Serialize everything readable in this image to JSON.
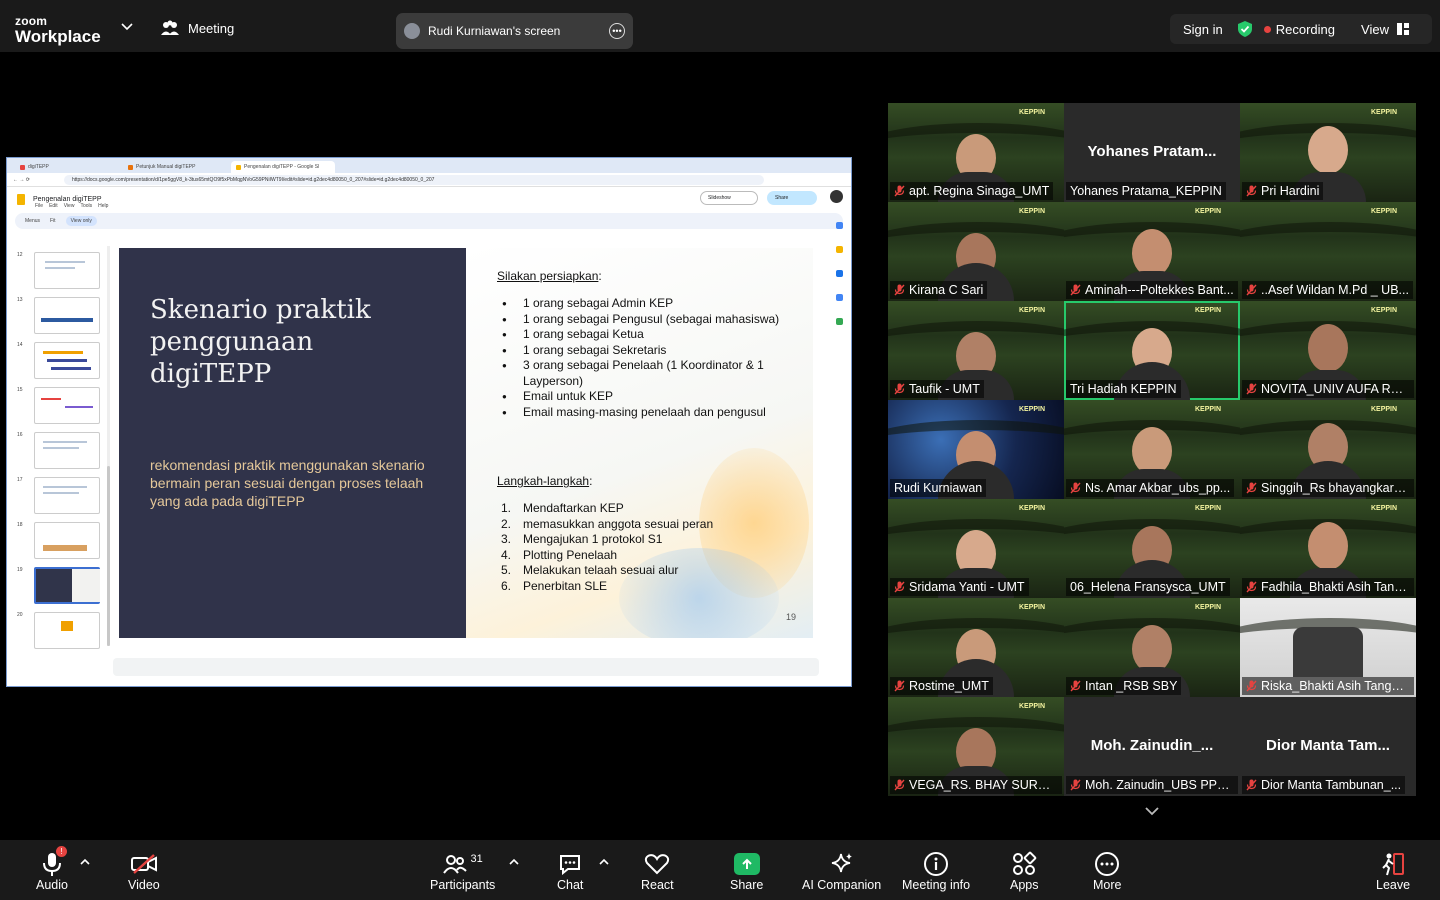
{
  "app": {
    "logo_line1": "zoom",
    "logo_line2": "Workplace",
    "meeting_label": "Meeting",
    "share_label": "Rudi Kurniawan's screen",
    "sign_in": "Sign in",
    "recording": "Recording",
    "view": "View"
  },
  "browser": {
    "tabs": [
      "digiTEPP",
      "Petunjuk Manual digiTEPP",
      "Pengenalan digiTEPP - Google Sl"
    ],
    "url": "https://docs.google.com/presentation/d/1pe5ggV8_k-3tus65mtQO9f5xPbMqgNVoG59PNiIWT9I/edit#slide=id.g2dec4d80050_0_207#slide=id.g2dec4d80050_0_207",
    "doc_title": "Pengenalan digiTEPP",
    "menus": [
      "File",
      "Edit",
      "View",
      "Tools",
      "Help"
    ],
    "slideshow": "Slideshow",
    "share": "Share",
    "toolbar_menus": "Menus",
    "toolbar_zoom": "Fit",
    "view_only": "View only",
    "thumb_numbers": [
      "12",
      "13",
      "14",
      "15",
      "16",
      "17",
      "18",
      "19",
      "20"
    ],
    "selected_slide": "19"
  },
  "slide": {
    "title": "Skenario praktik penggunaan digiTEPP",
    "subtitle": "rekomendasi praktik menggunakan skenario bermain peran sesuai dengan proses telaah yang ada pada digiTEPP",
    "prep_heading": "Silakan persiapkan",
    "prep_colon": ":",
    "prep_items": [
      "1 orang sebagai Admin KEP",
      "1 orang sebagai Pengusul (sebagai mahasiswa)",
      "1 orang sebagai Ketua",
      "1 orang sebagai Sekretaris",
      "3 orang sebagai Penelaah (1 Koordinator & 1 Layperson)",
      "Email untuk KEP",
      "Email masing-masing penelaah dan pengusul"
    ],
    "steps_heading": "Langkah-langkah",
    "steps_colon": ":",
    "steps": [
      "Mendaftarkan KEP",
      "memasukkan anggota sesuai peran",
      "Mengajukan 1 protokol S1",
      "Plotting Penelaah",
      "Melakukan telaah sesuai alur",
      "Penerbitan SLE"
    ],
    "page_number": "19"
  },
  "participants": [
    {
      "name": "apt. Regina Sinaga_UMT",
      "muted": true,
      "video": true,
      "big": ""
    },
    {
      "name": "Yohanes Pratama_KEPPIN",
      "muted": false,
      "video": false,
      "big": "Yohanes  Pratam..."
    },
    {
      "name": "Pri Hardini",
      "muted": true,
      "video": true,
      "big": ""
    },
    {
      "name": "Kirana C Sari",
      "muted": true,
      "video": true,
      "big": ""
    },
    {
      "name": "Aminah---Poltekkes Bant...",
      "muted": true,
      "video": true,
      "big": ""
    },
    {
      "name": "..Asef Wildan M.Pd _ UB...",
      "muted": true,
      "video": true,
      "big": ""
    },
    {
      "name": "Taufik - UMT",
      "muted": true,
      "video": true,
      "big": ""
    },
    {
      "name": "Tri Hadiah KEPPIN",
      "muted": false,
      "video": true,
      "big": ""
    },
    {
      "name": "NOVITA_UNIV AUFA RO...",
      "muted": true,
      "video": true,
      "big": ""
    },
    {
      "name": "Rudi Kurniawan",
      "muted": false,
      "video": true,
      "big": ""
    },
    {
      "name": "Ns. Amar Akbar_ubs_pp...",
      "muted": true,
      "video": true,
      "big": ""
    },
    {
      "name": "Singgih_Rs bhayangkara...",
      "muted": true,
      "video": true,
      "big": ""
    },
    {
      "name": "Sridama Yanti - UMT",
      "muted": true,
      "video": true,
      "big": ""
    },
    {
      "name": "06_Helena Fransysca_UMT",
      "muted": false,
      "video": true,
      "big": ""
    },
    {
      "name": "Fadhila_Bhakti Asih Tang...",
      "muted": true,
      "video": true,
      "big": ""
    },
    {
      "name": "Rostime_UMT",
      "muted": true,
      "video": true,
      "big": ""
    },
    {
      "name": "Intan _RSB SBY",
      "muted": true,
      "video": true,
      "big": ""
    },
    {
      "name": "Riska_Bhakti Asih Tanger...",
      "muted": true,
      "video": true,
      "big": ""
    },
    {
      "name": "VEGA_RS. BHAY SURABA...",
      "muted": true,
      "video": true,
      "big": ""
    },
    {
      "name": "Moh. Zainudin_UBS PPNI...",
      "muted": true,
      "video": false,
      "big": "Moh.  Zainudin_..."
    },
    {
      "name": "Dior Manta Tambunan_...",
      "muted": true,
      "video": false,
      "big": "Dior  Manta  Tam..."
    }
  ],
  "bottom": {
    "audio": "Audio",
    "audio_badge": "!",
    "video": "Video",
    "participants": "Participants",
    "participants_count": "31",
    "chat": "Chat",
    "react": "React",
    "share": "Share",
    "ai": "AI Companion",
    "info": "Meeting info",
    "apps": "Apps",
    "more": "More",
    "leave": "Leave"
  },
  "colors": {
    "accent_green": "#27c96b",
    "record_red": "#e64340",
    "share_green": "#1fb964",
    "slide_dark": "#30334a",
    "slide_subtitle": "#e5c89a"
  }
}
